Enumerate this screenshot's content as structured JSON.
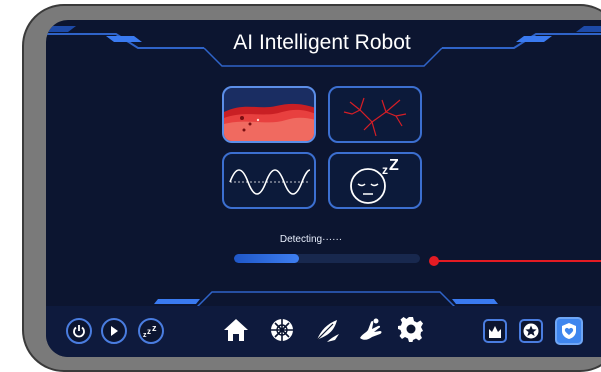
{
  "header": {
    "title": "AI Intelligent Robot"
  },
  "tiles": [
    {
      "name": "skin-analysis",
      "icon": "skin-scan-icon",
      "active": true
    },
    {
      "name": "vascular-analysis",
      "icon": "blood-vessel-icon",
      "active": false
    },
    {
      "name": "wave-analysis",
      "icon": "sine-wave-icon",
      "active": false
    },
    {
      "name": "sleep-analysis",
      "icon": "sleepy-face-icon",
      "active": false
    }
  ],
  "status": {
    "label": "Detecting······",
    "progress": 0.35
  },
  "left_controls": [
    "power-icon",
    "play-icon",
    "sleep-zzz-icon"
  ],
  "nav_icons": [
    "home-icon",
    "globe-icon",
    "feather-icon",
    "hand-icon",
    "gear-icon"
  ],
  "right_controls": [
    "crown-icon",
    "star-icon",
    "heart-shield-icon"
  ],
  "colors": {
    "accent": "#3e7ef0",
    "alert": "#e41b23",
    "background": "#0c1530",
    "frame": "#7a7a7a"
  }
}
